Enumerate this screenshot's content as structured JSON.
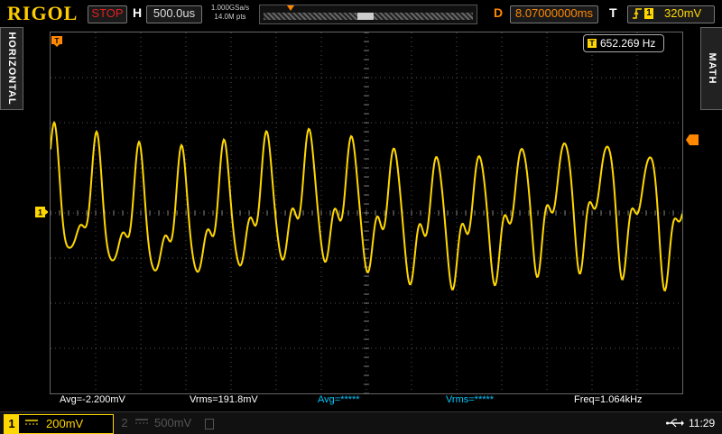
{
  "header": {
    "brand": "RIGOL",
    "status": "STOP",
    "horizontal_label": "H",
    "timebase": "500.0us",
    "sample_rate": "1.000GSa/s",
    "memory_depth": "14.0M pts",
    "delay_label": "D",
    "delay_value": "8.07000000ms",
    "trigger_label": "T",
    "trigger_channel": "1",
    "trigger_level": "320mV"
  },
  "side": {
    "left_tab": "HORIZONTAL",
    "right_tab": "MATH"
  },
  "screen": {
    "freq_counter_icon": "T",
    "freq_counter": "652.269 Hz",
    "ch1_marker": "1",
    "trigger_position_marker": "T"
  },
  "measurements": [
    {
      "text": "Avg=-2.200mV",
      "color": "#ffd700"
    },
    {
      "text": "Vrms=191.8mV",
      "color": "#ffd700"
    },
    {
      "text": "Avg=*****",
      "color": "#00c8ff"
    },
    {
      "text": "Vrms=*****",
      "color": "#00c8ff"
    },
    {
      "text": "Freq=1.064kHz",
      "color": "#ffd700"
    }
  ],
  "bottom": {
    "ch1_num": "1",
    "ch1_coupling": "DC",
    "ch1_scale": "200mV",
    "ch2_num": "2",
    "ch2_coupling": "DC",
    "ch2_scale": "500mV",
    "time": "11:29"
  },
  "colors": {
    "ch1": "#ffd700",
    "ch2": "#00c8ff",
    "trigger": "#ff8800",
    "stop": "#e02020"
  },
  "icons": {
    "trigger_edge": "rising-edge-icon",
    "usb": "usb-icon",
    "coupling": "dc-coupling-icon"
  }
}
